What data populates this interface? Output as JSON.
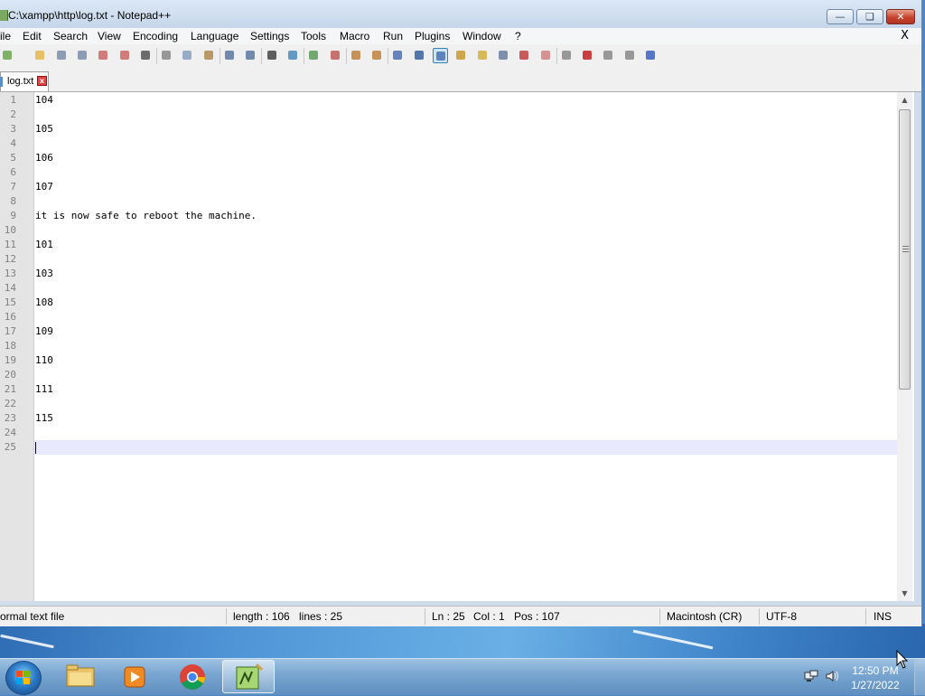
{
  "window": {
    "title": "C:\\xampp\\http\\log.txt - Notepad++"
  },
  "menu": {
    "items": [
      "ile",
      "Edit",
      "Search",
      "View",
      "Encoding",
      "Language",
      "Settings",
      "Tools",
      "Macro",
      "Run",
      "Plugins",
      "Window",
      "?"
    ],
    "close_label": "X"
  },
  "toolbar": {
    "icons": [
      "new-file-icon",
      "open-file-icon",
      "save-icon",
      "save-all-icon",
      "close-icon",
      "close-all-icon",
      "print-icon",
      "cut-icon",
      "copy-icon",
      "paste-icon",
      "undo-icon",
      "redo-icon",
      "find-icon",
      "replace-icon",
      "zoom-in-icon",
      "zoom-out-icon",
      "sync-vertical-icon",
      "sync-horizontal-icon",
      "word-wrap-icon",
      "show-all-chars-icon",
      "indent-guide-icon",
      "user-language-icon",
      "document-map-icon",
      "function-list-icon",
      "folder-as-workspace-icon",
      "monitoring-icon",
      "start-record-icon",
      "stop-record-icon",
      "play-macro-icon",
      "run-macro-multiple-icon",
      "save-macro-icon"
    ]
  },
  "tab": {
    "label": "log.txt",
    "close_glyph": "x"
  },
  "editor": {
    "lines": [
      {
        "n": "1",
        "text": "104"
      },
      {
        "n": "2",
        "text": ""
      },
      {
        "n": "3",
        "text": "105"
      },
      {
        "n": "4",
        "text": ""
      },
      {
        "n": "5",
        "text": "106"
      },
      {
        "n": "6",
        "text": ""
      },
      {
        "n": "7",
        "text": "107"
      },
      {
        "n": "8",
        "text": ""
      },
      {
        "n": "9",
        "text": "it is now safe to reboot the machine."
      },
      {
        "n": "10",
        "text": ""
      },
      {
        "n": "11",
        "text": "101"
      },
      {
        "n": "12",
        "text": ""
      },
      {
        "n": "13",
        "text": "103"
      },
      {
        "n": "14",
        "text": ""
      },
      {
        "n": "15",
        "text": "108"
      },
      {
        "n": "16",
        "text": ""
      },
      {
        "n": "17",
        "text": "109"
      },
      {
        "n": "18",
        "text": ""
      },
      {
        "n": "19",
        "text": "110"
      },
      {
        "n": "20",
        "text": ""
      },
      {
        "n": "21",
        "text": "111"
      },
      {
        "n": "22",
        "text": ""
      },
      {
        "n": "23",
        "text": "115"
      },
      {
        "n": "24",
        "text": ""
      },
      {
        "n": "25",
        "text": ""
      }
    ],
    "current_line": 25
  },
  "status": {
    "file_type": "ormal text file",
    "length": "length : 106",
    "lines": "lines : 25",
    "ln": "Ln : 25",
    "col": "Col : 1",
    "pos": "Pos : 107",
    "eol": "Macintosh (CR)",
    "encoding": "UTF-8",
    "mode": "INS"
  },
  "taskbar": {
    "pinned": [
      "windows-explorer-icon",
      "media-player-icon",
      "chrome-icon",
      "notepad-plus-plus-icon"
    ],
    "active": "notepad-plus-plus-icon",
    "time": "12:50 PM",
    "date": "1/27/2022"
  },
  "colors": {
    "current_line_highlight": "#e8e8ff",
    "gutter": "#e4e4e4",
    "close_button": "#c8432c"
  }
}
